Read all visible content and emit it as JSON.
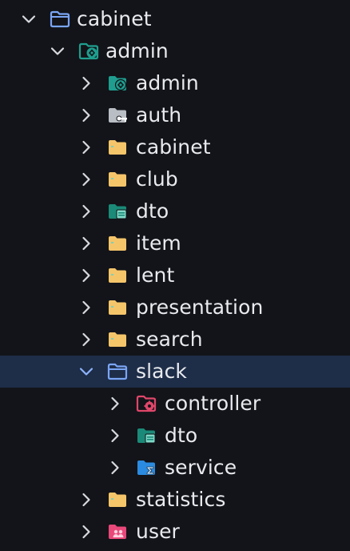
{
  "tree": {
    "root": {
      "label": "cabinet",
      "icon": "folder-open-outline-icon"
    },
    "admin": {
      "label": "admin",
      "icon": "folder-admin-open-icon"
    },
    "items": [
      {
        "label": "admin",
        "icon": "folder-admin-icon",
        "expanded": false
      },
      {
        "label": "auth",
        "icon": "folder-key-icon",
        "expanded": false
      },
      {
        "label": "cabinet",
        "icon": "folder-icon",
        "expanded": false
      },
      {
        "label": "club",
        "icon": "folder-icon",
        "expanded": false
      },
      {
        "label": "dto",
        "icon": "folder-dto-icon",
        "expanded": false
      },
      {
        "label": "item",
        "icon": "folder-icon",
        "expanded": false
      },
      {
        "label": "lent",
        "icon": "folder-icon",
        "expanded": false
      },
      {
        "label": "presentation",
        "icon": "folder-icon",
        "expanded": false
      },
      {
        "label": "search",
        "icon": "folder-icon",
        "expanded": false
      },
      {
        "label": "slack",
        "icon": "folder-open-outline-icon",
        "expanded": true,
        "selected": true
      },
      {
        "label": "controller",
        "icon": "folder-controller-icon",
        "expanded": false
      },
      {
        "label": "dto",
        "icon": "folder-dto-icon",
        "expanded": false
      },
      {
        "label": "service",
        "icon": "folder-service-icon",
        "expanded": false
      },
      {
        "label": "statistics",
        "icon": "folder-icon",
        "expanded": false
      },
      {
        "label": "user",
        "icon": "folder-user-icon",
        "expanded": false
      }
    ]
  },
  "colors": {
    "background": "#121419",
    "selected_row": "#1e2d48",
    "text": "#e8eaee",
    "chevron": "#d7dae0",
    "chevron_selected": "#8db4ff",
    "folder_yellow": "#f5c56a",
    "folder_teal": "#1f9e8f",
    "folder_gray": "#b9bdc4",
    "folder_blue_outline": "#7aa5f5",
    "folder_red": "#e0466a",
    "folder_blue": "#2b8be0",
    "folder_pink": "#e8487a"
  }
}
